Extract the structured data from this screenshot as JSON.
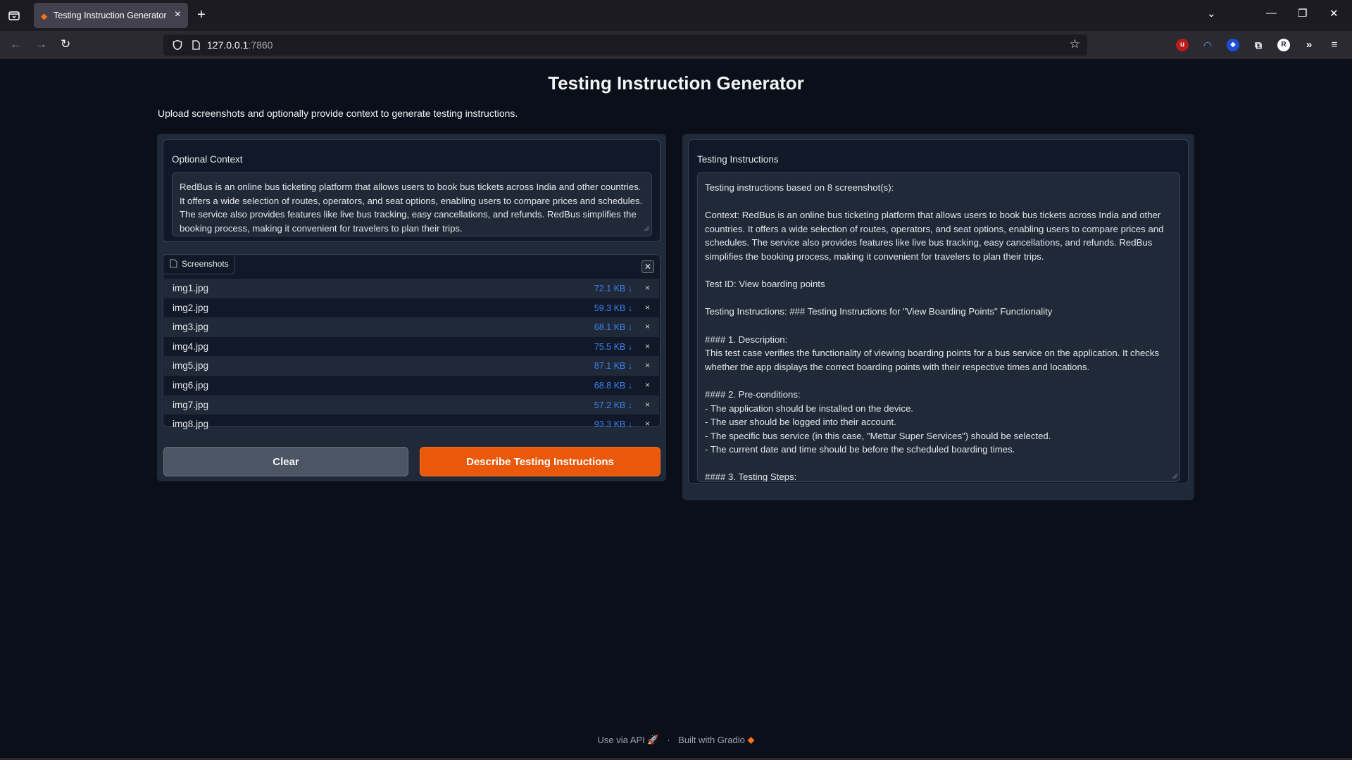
{
  "browser": {
    "tab_title": "Testing Instruction Generator",
    "url_host": "127.0.0.1",
    "url_port": ":7860"
  },
  "page": {
    "title": "Testing Instruction Generator",
    "subtitle": "Upload screenshots and optionally provide context to generate testing instructions."
  },
  "context": {
    "label": "Optional Context",
    "value": "RedBus is an online bus ticketing platform that allows users to book bus tickets across India and other countries. It offers a wide selection of routes, operators, and seat options, enabling users to compare prices and schedules. The service also provides features like live bus tracking, easy cancellations, and refunds. RedBus simplifies the booking process, making it convenient for travelers to plan their trips."
  },
  "files": {
    "label": "Screenshots",
    "items": [
      {
        "name": "img1.jpg",
        "size": "72.1 KB ↓"
      },
      {
        "name": "img2.jpg",
        "size": "59.3 KB ↓"
      },
      {
        "name": "img3.jpg",
        "size": "68.1 KB ↓"
      },
      {
        "name": "img4.jpg",
        "size": "75.5 KB ↓"
      },
      {
        "name": "img5.jpg",
        "size": "87.1 KB ↓"
      },
      {
        "name": "img6.jpg",
        "size": "68.8 KB ↓"
      },
      {
        "name": "img7.jpg",
        "size": "57.2 KB ↓"
      },
      {
        "name": "img8.jpg",
        "size": "93.3 KB ↓"
      }
    ]
  },
  "buttons": {
    "clear": "Clear",
    "submit": "Describe Testing Instructions"
  },
  "output": {
    "label": "Testing Instructions",
    "value": "Testing instructions based on 8 screenshot(s):\n\nContext: RedBus is an online bus ticketing platform that allows users to book bus tickets across India and other countries. It offers a wide selection of routes, operators, and seat options, enabling users to compare prices and schedules. The service also provides features like live bus tracking, easy cancellations, and refunds. RedBus simplifies the booking process, making it convenient for travelers to plan their trips.\n\nTest ID: View boarding points\n\nTesting Instructions: ### Testing Instructions for \"View Boarding Points\" Functionality\n\n#### 1. Description:\nThis test case verifies the functionality of viewing boarding points for a bus service on the application. It checks whether the app displays the correct boarding points with their respective times and locations.\n\n#### 2. Pre-conditions:\n- The application should be installed on the device.\n- The user should be logged into their account.\n- The specific bus service (in this case, \"Mettur Super Services\") should be selected.\n- The current date and time should be before the scheduled boarding times.\n\n#### 3. Testing Steps:"
  },
  "footer": {
    "api": "Use via API",
    "separator": "·",
    "built": "Built with Gradio"
  },
  "colors": {
    "background": "#0b0f19",
    "panel": "#1f2937",
    "accent": "#ea580c",
    "link": "#3b82f6"
  }
}
